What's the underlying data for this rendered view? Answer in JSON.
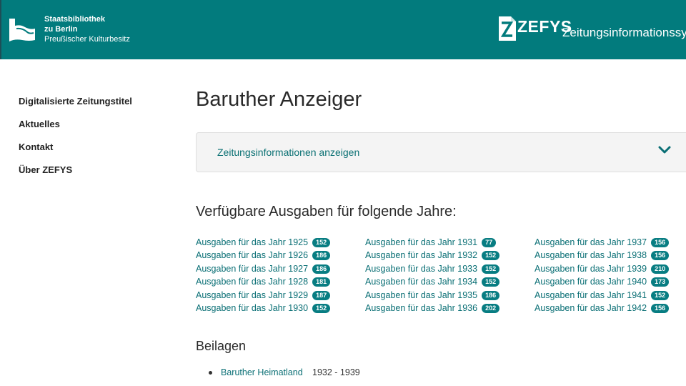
{
  "header": {
    "library": {
      "line1": "Staatsbibliothek",
      "line2": "zu Berlin",
      "line3": "Preußischer Kulturbesitz"
    },
    "zefys": {
      "name": "ZEFYS",
      "subtitle": "Zeitungsinformationssyst"
    },
    "brand_color": "#027b7d"
  },
  "nav": {
    "items": [
      {
        "label": "Digitalisierte Zeitungstitel"
      },
      {
        "label": "Aktuelles"
      },
      {
        "label": "Kontakt"
      },
      {
        "label": "Über ZEFYS"
      }
    ]
  },
  "main": {
    "title": "Baruther Anzeiger",
    "accordion_label": "Zeitungsinformationen anzeigen",
    "years_heading": "Verfügbare Ausgaben für folgende Jahre:",
    "years": [
      [
        {
          "label": "Ausgaben für das Jahr 1925",
          "count": "152"
        },
        {
          "label": "Ausgaben für das Jahr 1926",
          "count": "186"
        },
        {
          "label": "Ausgaben für das Jahr 1927",
          "count": "186"
        },
        {
          "label": "Ausgaben für das Jahr 1928",
          "count": "181"
        },
        {
          "label": "Ausgaben für das Jahr 1929",
          "count": "187"
        },
        {
          "label": "Ausgaben für das Jahr 1930",
          "count": "152"
        }
      ],
      [
        {
          "label": "Ausgaben für das Jahr 1931",
          "count": "77"
        },
        {
          "label": "Ausgaben für das Jahr 1932",
          "count": "152"
        },
        {
          "label": "Ausgaben für das Jahr 1933",
          "count": "152"
        },
        {
          "label": "Ausgaben für das Jahr 1934",
          "count": "152"
        },
        {
          "label": "Ausgaben für das Jahr 1935",
          "count": "186"
        },
        {
          "label": "Ausgaben für das Jahr 1936",
          "count": "202"
        }
      ],
      [
        {
          "label": "Ausgaben für das Jahr 1937",
          "count": "156"
        },
        {
          "label": "Ausgaben für das Jahr 1938",
          "count": "156"
        },
        {
          "label": "Ausgaben für das Jahr 1939",
          "count": "210"
        },
        {
          "label": "Ausgaben für das Jahr 1940",
          "count": "173"
        },
        {
          "label": "Ausgaben für das Jahr 1941",
          "count": "152"
        },
        {
          "label": "Ausgaben für das Jahr 1942",
          "count": "156"
        }
      ]
    ],
    "supplements_heading": "Beilagen",
    "supplements": [
      {
        "title": "Baruther Heimatland",
        "range": "1932 - 1939"
      }
    ]
  }
}
